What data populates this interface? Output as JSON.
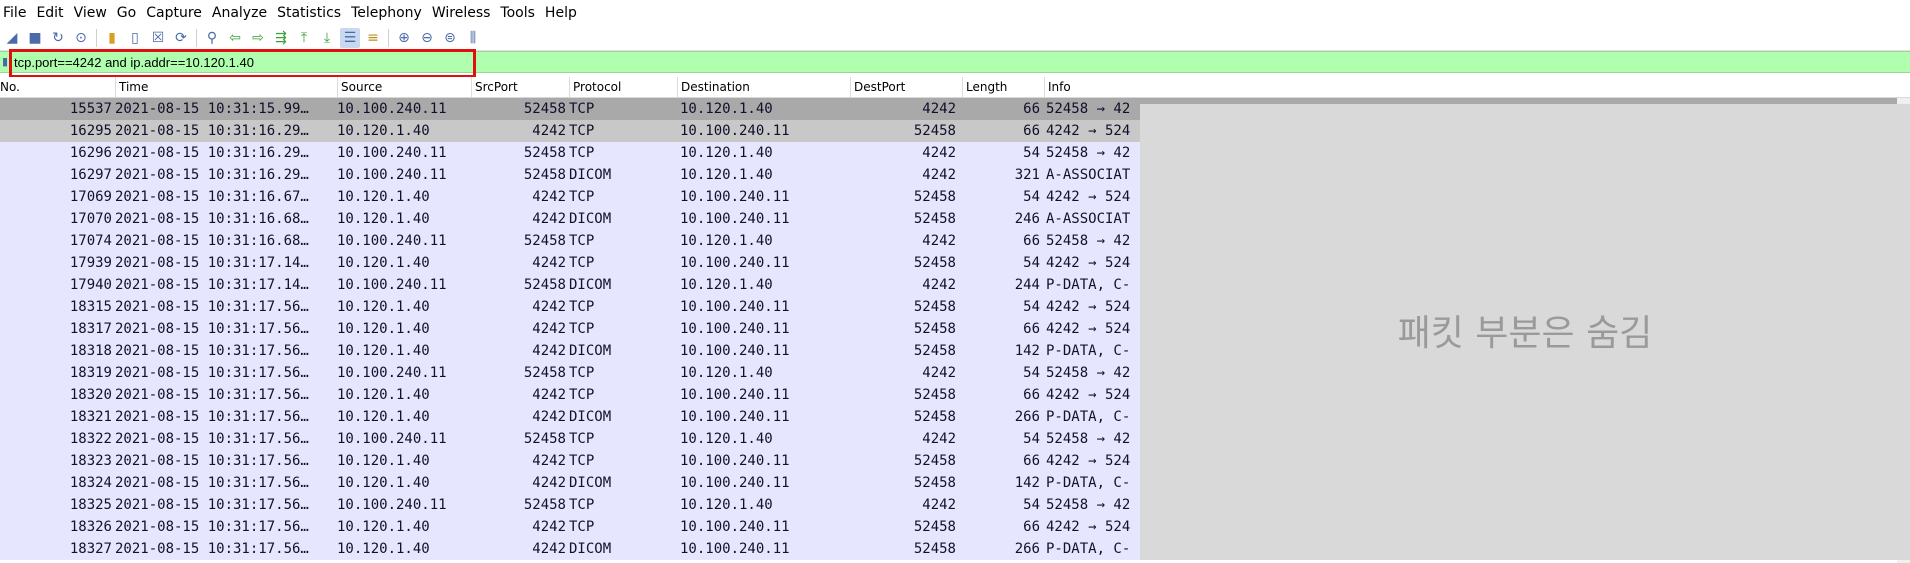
{
  "menu": [
    "File",
    "Edit",
    "View",
    "Go",
    "Capture",
    "Analyze",
    "Statistics",
    "Telephony",
    "Wireless",
    "Tools",
    "Help"
  ],
  "toolbar_icons": [
    "shark-fin-start-icon",
    "stop-icon",
    "restart-icon",
    "options-gear-icon",
    "open-folder-icon",
    "file-icon",
    "close-file-icon",
    "reload-icon",
    "find-icon",
    "go-back-icon",
    "go-forward-icon",
    "go-to-packet-icon",
    "first-packet-icon",
    "last-packet-icon",
    "autoscroll-icon",
    "colorize-icon",
    "zoom-in-icon",
    "zoom-out-icon",
    "normal-size-icon",
    "resize-columns-icon"
  ],
  "filter": {
    "value": "tcp.port==4242 and ip.addr==10.120.1.40"
  },
  "columns": [
    "No.",
    "Time",
    "Source",
    "SrcPort",
    "Protocol",
    "Destination",
    "DestPort",
    "Length",
    "Info"
  ],
  "rows": [
    {
      "no": "15537",
      "time": "2021-08-15 10:31:15.99…",
      "src": "10.100.240.11",
      "sport": "52458",
      "proto": "TCP",
      "dst": "10.120.1.40",
      "dport": "4242",
      "len": "66",
      "info": "52458 → 42"
    },
    {
      "no": "16295",
      "time": "2021-08-15 10:31:16.29…",
      "src": "10.120.1.40",
      "sport": "4242",
      "proto": "TCP",
      "dst": "10.100.240.11",
      "dport": "52458",
      "len": "66",
      "info": "4242 → 524"
    },
    {
      "no": "16296",
      "time": "2021-08-15 10:31:16.29…",
      "src": "10.100.240.11",
      "sport": "52458",
      "proto": "TCP",
      "dst": "10.120.1.40",
      "dport": "4242",
      "len": "54",
      "info": "52458 → 42"
    },
    {
      "no": "16297",
      "time": "2021-08-15 10:31:16.29…",
      "src": "10.100.240.11",
      "sport": "52458",
      "proto": "DICOM",
      "dst": "10.120.1.40",
      "dport": "4242",
      "len": "321",
      "info": "A-ASSOCIAT"
    },
    {
      "no": "17069",
      "time": "2021-08-15 10:31:16.67…",
      "src": "10.120.1.40",
      "sport": "4242",
      "proto": "TCP",
      "dst": "10.100.240.11",
      "dport": "52458",
      "len": "54",
      "info": "4242 → 524"
    },
    {
      "no": "17070",
      "time": "2021-08-15 10:31:16.68…",
      "src": "10.120.1.40",
      "sport": "4242",
      "proto": "DICOM",
      "dst": "10.100.240.11",
      "dport": "52458",
      "len": "246",
      "info": "A-ASSOCIAT"
    },
    {
      "no": "17074",
      "time": "2021-08-15 10:31:16.68…",
      "src": "10.100.240.11",
      "sport": "52458",
      "proto": "TCP",
      "dst": "10.120.1.40",
      "dport": "4242",
      "len": "66",
      "info": "52458 → 42"
    },
    {
      "no": "17939",
      "time": "2021-08-15 10:31:17.14…",
      "src": "10.120.1.40",
      "sport": "4242",
      "proto": "TCP",
      "dst": "10.100.240.11",
      "dport": "52458",
      "len": "54",
      "info": "4242 → 524"
    },
    {
      "no": "17940",
      "time": "2021-08-15 10:31:17.14…",
      "src": "10.100.240.11",
      "sport": "52458",
      "proto": "DICOM",
      "dst": "10.120.1.40",
      "dport": "4242",
      "len": "244",
      "info": "P-DATA, C-"
    },
    {
      "no": "18315",
      "time": "2021-08-15 10:31:17.56…",
      "src": "10.120.1.40",
      "sport": "4242",
      "proto": "TCP",
      "dst": "10.100.240.11",
      "dport": "52458",
      "len": "54",
      "info": "4242 → 524"
    },
    {
      "no": "18317",
      "time": "2021-08-15 10:31:17.56…",
      "src": "10.120.1.40",
      "sport": "4242",
      "proto": "TCP",
      "dst": "10.100.240.11",
      "dport": "52458",
      "len": "66",
      "info": "4242 → 524"
    },
    {
      "no": "18318",
      "time": "2021-08-15 10:31:17.56…",
      "src": "10.120.1.40",
      "sport": "4242",
      "proto": "DICOM",
      "dst": "10.100.240.11",
      "dport": "52458",
      "len": "142",
      "info": "P-DATA, C-"
    },
    {
      "no": "18319",
      "time": "2021-08-15 10:31:17.56…",
      "src": "10.100.240.11",
      "sport": "52458",
      "proto": "TCP",
      "dst": "10.120.1.40",
      "dport": "4242",
      "len": "54",
      "info": "52458 → 42"
    },
    {
      "no": "18320",
      "time": "2021-08-15 10:31:17.56…",
      "src": "10.120.1.40",
      "sport": "4242",
      "proto": "TCP",
      "dst": "10.100.240.11",
      "dport": "52458",
      "len": "66",
      "info": "4242 → 524"
    },
    {
      "no": "18321",
      "time": "2021-08-15 10:31:17.56…",
      "src": "10.120.1.40",
      "sport": "4242",
      "proto": "DICOM",
      "dst": "10.100.240.11",
      "dport": "52458",
      "len": "266",
      "info": "P-DATA, C-"
    },
    {
      "no": "18322",
      "time": "2021-08-15 10:31:17.56…",
      "src": "10.100.240.11",
      "sport": "52458",
      "proto": "TCP",
      "dst": "10.120.1.40",
      "dport": "4242",
      "len": "54",
      "info": "52458 → 42"
    },
    {
      "no": "18323",
      "time": "2021-08-15 10:31:17.56…",
      "src": "10.120.1.40",
      "sport": "4242",
      "proto": "TCP",
      "dst": "10.100.240.11",
      "dport": "52458",
      "len": "66",
      "info": "4242 → 524"
    },
    {
      "no": "18324",
      "time": "2021-08-15 10:31:17.56…",
      "src": "10.120.1.40",
      "sport": "4242",
      "proto": "DICOM",
      "dst": "10.100.240.11",
      "dport": "52458",
      "len": "142",
      "info": "P-DATA, C-"
    },
    {
      "no": "18325",
      "time": "2021-08-15 10:31:17.56…",
      "src": "10.100.240.11",
      "sport": "52458",
      "proto": "TCP",
      "dst": "10.120.1.40",
      "dport": "4242",
      "len": "54",
      "info": "52458 → 42"
    },
    {
      "no": "18326",
      "time": "2021-08-15 10:31:17.56…",
      "src": "10.120.1.40",
      "sport": "4242",
      "proto": "TCP",
      "dst": "10.100.240.11",
      "dport": "52458",
      "len": "66",
      "info": "4242 → 524"
    },
    {
      "no": "18327",
      "time": "2021-08-15 10:31:17.56…",
      "src": "10.120.1.40",
      "sport": "4242",
      "proto": "DICOM",
      "dst": "10.100.240.11",
      "dport": "52458",
      "len": "266",
      "info": "P-DATA, C-"
    }
  ],
  "overlay": {
    "text": "패킷 부분은 숨김"
  },
  "colors": {
    "row_bg": "#e7e6ff",
    "selected_row": "#a9a9a9",
    "filter_bg": "#afffaf",
    "highlight": "#e01010"
  }
}
